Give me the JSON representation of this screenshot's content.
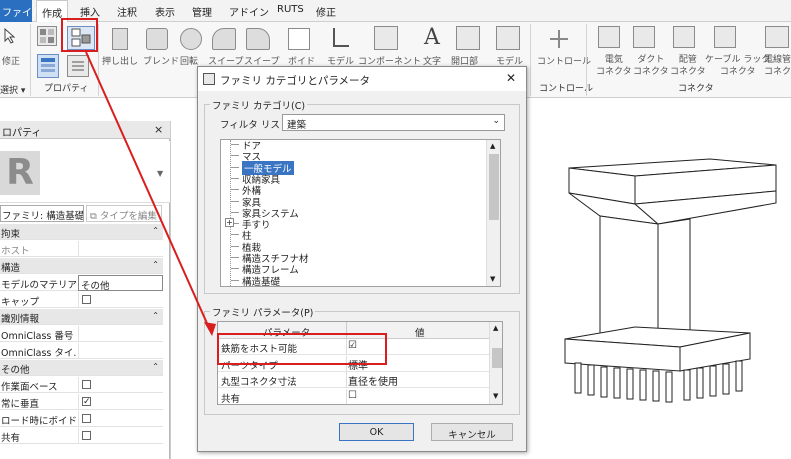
{
  "menu": {
    "file": "ファイル",
    "items": [
      "作成",
      "挿入",
      "注釈",
      "表示",
      "管理",
      "アドイン",
      "RUTS",
      "修正"
    ]
  },
  "ribbon": {
    "left_labels": {
      "modify": "修正",
      "select": "選択 ▾",
      "properties": "プロパティ"
    },
    "tools": [
      "押し出し",
      "ブレンド",
      "回転",
      "スイープ",
      "スイープ",
      "ボイド"
    ],
    "tool_more": [
      "モデル",
      "コンポーネント",
      "文字",
      "開口部",
      "モデル"
    ],
    "control": "コントロール",
    "control_group": "コントロール",
    "connectors": [
      "電気\nコネクタ",
      "ダクト\nコネクタ",
      "配管\nコネクタ",
      "ケーブル ラック\nコネクタ",
      "電線管\nコネク"
    ],
    "connector_group": "コネクタ"
  },
  "props": {
    "title": "ロパティ",
    "close": "×",
    "type_selector": "ファミリ: 構造基礎",
    "edit_type": "タイプを編集",
    "rows": [
      {
        "kind": "sec",
        "label": "拘束"
      },
      {
        "kind": "row",
        "label": "ホスト",
        "muted": true
      },
      {
        "kind": "sec",
        "label": "構造"
      },
      {
        "kind": "row",
        "label": "モデルのマテリア...",
        "value": "その他"
      },
      {
        "kind": "check",
        "label": "キャップ",
        "checked": false
      },
      {
        "kind": "sec",
        "label": "識別情報"
      },
      {
        "kind": "row",
        "label": "OmniClass 番号"
      },
      {
        "kind": "row",
        "label": "OmniClass タイ..."
      },
      {
        "kind": "sec",
        "label": "その他"
      },
      {
        "kind": "check",
        "label": "作業面ベース",
        "checked": false
      },
      {
        "kind": "check",
        "label": "常に垂直",
        "checked": true
      },
      {
        "kind": "check",
        "label": "ロード時にボイドで...",
        "checked": false
      },
      {
        "kind": "check",
        "label": "共有",
        "checked": false
      }
    ]
  },
  "dialog": {
    "title": "ファミリ カテゴリとパラメータ",
    "close": "✕",
    "category_group": "ファミリ カテゴリ(C)",
    "filter_label": "フィルタ リスト:",
    "filter_value": "建築",
    "categories": [
      "ドア",
      "マス",
      "一般モデル",
      "収納家具",
      "外構",
      "家具",
      "家具システム",
      "手すり",
      "柱",
      "植栽",
      "構造スチフナ材",
      "構造フレーム",
      "構造基礎"
    ],
    "selected_category": "一般モデル",
    "params_group": "ファミリ パラメータ(P)",
    "col_param": "パラメータ",
    "col_value": "値",
    "params": [
      {
        "name": "鉄筋をホスト可能",
        "value": "☑"
      },
      {
        "name": "パーツタイプ",
        "value": "標準"
      },
      {
        "name": "丸型コネクタ寸法",
        "value": "直径を使用"
      },
      {
        "name": "共有",
        "value": "☐"
      }
    ],
    "ok": "OK",
    "cancel": "キャンセル"
  },
  "colors": {
    "accent": "#2b6fc0",
    "highlight": "#d81e1e",
    "selection": "#3a75c4"
  }
}
